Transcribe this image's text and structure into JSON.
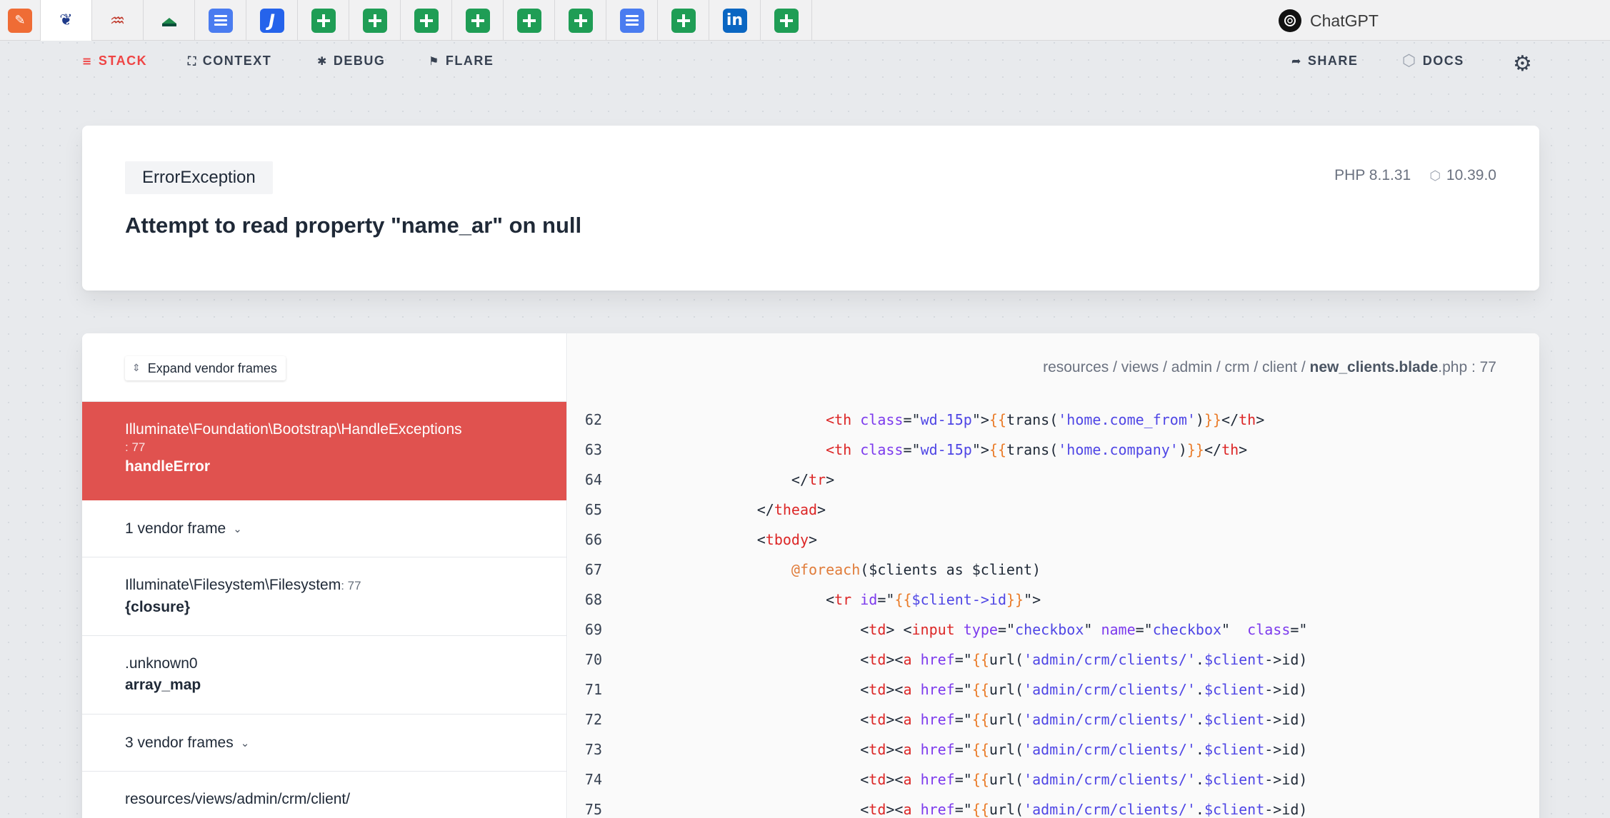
{
  "chatgpt_tab": {
    "label": "ChatGPT"
  },
  "nav": {
    "stack": "STACK",
    "context": "CONTEXT",
    "debug": "DEBUG",
    "flare": "FLARE",
    "share": "SHARE",
    "docs": "DOCS"
  },
  "error": {
    "exception_class": "ErrorException",
    "message": "Attempt to read property \"name_ar\" on null",
    "php_version": "PHP 8.1.31",
    "laravel_version": "10.39.0"
  },
  "stack": {
    "expand_label": "Expand vendor frames",
    "frames": [
      {
        "class": "Illuminate\\Foundation\\Bootstrap\\HandleExceptions",
        "line": ": 77",
        "fn": "handleError"
      },
      {
        "vendor": "1 vendor frame"
      },
      {
        "class": "Illuminate\\Filesystem\\Filesystem",
        "line": ": 77",
        "fn": "{closure}"
      },
      {
        "class": ".unknown0",
        "line": "",
        "fn": "array_map"
      },
      {
        "vendor": "3 vendor frames"
      },
      {
        "class": "resources/views/admin/crm/client/",
        "line": "",
        "fn": ""
      }
    ]
  },
  "code": {
    "path_dirs": "resources / views / admin / crm / client / ",
    "path_file": "new_clients.blade",
    "path_ext": ".php",
    "path_line": " : 77",
    "lines": [
      {
        "n": "62",
        "html": "                          <span class='t-tag'>&lt;th</span> <span class='t-attr'>class</span>=\"<span class='t-str'>wd-15p</span>\"&gt;<span class='t-blade'>{{</span>trans(<span class='t-str'>'home.come_from'</span>)<span class='t-blade'>}}</span>&lt;/<span class='t-tag'>th</span>&gt;"
      },
      {
        "n": "63",
        "html": "                          <span class='t-tag'>&lt;th</span> <span class='t-attr'>class</span>=\"<span class='t-str'>wd-15p</span>\"&gt;<span class='t-blade'>{{</span>trans(<span class='t-str'>'home.company'</span>)<span class='t-blade'>}}</span>&lt;/<span class='t-tag'>th</span>&gt;"
      },
      {
        "n": "64",
        "html": "                      &lt;/<span class='t-tag'>tr</span>&gt;"
      },
      {
        "n": "65",
        "html": "                  &lt;/<span class='t-tag'>thead</span>&gt;"
      },
      {
        "n": "66",
        "html": "                  &lt;<span class='t-tag'>tbody</span>&gt;"
      },
      {
        "n": "67",
        "html": "                      <span class='t-dir'>@foreach</span>($clients as $client)"
      },
      {
        "n": "68",
        "html": "                          &lt;<span class='t-tag'>tr</span> <span class='t-attr'>id</span>=\"<span class='t-blade'>{{</span><span class='t-str'>$client-&gt;id</span><span class='t-blade'>}}</span>\"&gt;"
      },
      {
        "n": "69",
        "html": "                              &lt;<span class='t-tag'>td</span>&gt; &lt;<span class='t-tag'>input</span> <span class='t-attr'>type</span>=\"<span class='t-str'>checkbox</span>\" <span class='t-attr'>name</span>=\"<span class='t-str'>checkbox</span>\"  <span class='t-attr'>class</span>=\""
      },
      {
        "n": "70",
        "html": "                              &lt;<span class='t-tag'>td</span>&gt;&lt;<span class='t-tag'>a</span> <span class='t-attr'>href</span>=\"<span class='t-blade'>{{</span>url(<span class='t-str'>'admin/crm/clients/'</span>.<span class='t-str'>$client</span>-&gt;id)"
      },
      {
        "n": "71",
        "html": "                              &lt;<span class='t-tag'>td</span>&gt;&lt;<span class='t-tag'>a</span> <span class='t-attr'>href</span>=\"<span class='t-blade'>{{</span>url(<span class='t-str'>'admin/crm/clients/'</span>.<span class='t-str'>$client</span>-&gt;id)"
      },
      {
        "n": "72",
        "html": "                              &lt;<span class='t-tag'>td</span>&gt;&lt;<span class='t-tag'>a</span> <span class='t-attr'>href</span>=\"<span class='t-blade'>{{</span>url(<span class='t-str'>'admin/crm/clients/'</span>.<span class='t-str'>$client</span>-&gt;id)"
      },
      {
        "n": "73",
        "html": "                              &lt;<span class='t-tag'>td</span>&gt;&lt;<span class='t-tag'>a</span> <span class='t-attr'>href</span>=\"<span class='t-blade'>{{</span>url(<span class='t-str'>'admin/crm/clients/'</span>.<span class='t-str'>$client</span>-&gt;id)"
      },
      {
        "n": "74",
        "html": "                              &lt;<span class='t-tag'>td</span>&gt;&lt;<span class='t-tag'>a</span> <span class='t-attr'>href</span>=\"<span class='t-blade'>{{</span>url(<span class='t-str'>'admin/crm/clients/'</span>.<span class='t-str'>$client</span>-&gt;id)"
      },
      {
        "n": "75",
        "html": "                              &lt;<span class='t-tag'>td</span>&gt;&lt;<span class='t-tag'>a</span> <span class='t-attr'>href</span>=\"<span class='t-blade'>{{</span>url(<span class='t-str'>'admin/crm/clients/'</span>.<span class='t-str'>$client</span>-&gt;id)"
      }
    ]
  }
}
